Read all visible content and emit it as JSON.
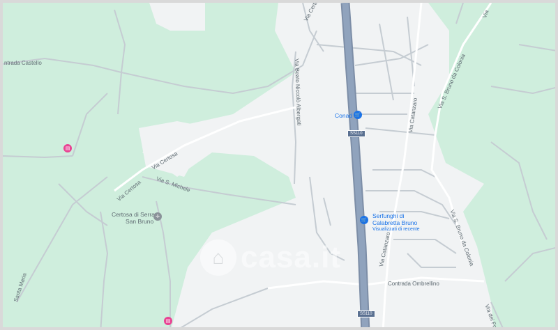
{
  "map": {
    "road_labels": {
      "strada_castello": "ntrada Castello",
      "via_certosa_upper": "Via Certosa",
      "via_certosa_lower": "Via Certosa",
      "via_s_michele": "Via S. Michele",
      "santa_maria": "Santa Maria",
      "via_beato": "Via Beato Niccolò Albergati",
      "via_catanzaro_upper": "Via Catanzaro",
      "via_catanzaro_lower": "Via Catanzaro",
      "via_bruno_upper": "Via S. Bruno da Colonia",
      "via_bruno_lower": "Via S. Bruno da Colonia",
      "contrada_ombrellino": "Contrada Ombrellino",
      "via_certosa_top": "Via Certosa",
      "via_top_right": "Via",
      "via_dei_fo": "Via dei Fo"
    },
    "route_shields": {
      "ss110_upper": "SS110",
      "ss110_lower": "SS110"
    },
    "pois": {
      "conad": {
        "name": "Conad",
        "icon": "shopping-cart-icon"
      },
      "serfunghi": {
        "name_line1": "Serfunghi di",
        "name_line2": "Calabretta Bruno",
        "subtitle": "Visualizzati di recente",
        "icon": "shopping-cart-icon"
      },
      "certosa": {
        "name_line1": "Certosa di Serra",
        "name_line2": "San Bruno",
        "icon": "church-icon"
      },
      "hotel": {
        "icon": "bed-icon"
      },
      "bottom_pin": {
        "icon": "bed-icon"
      }
    },
    "watermark": {
      "text": "casa.it"
    },
    "colors": {
      "park": "#cfeedd",
      "urban": "#f1f3f4",
      "road": "#ffffff",
      "road_outline": "#c5ccd2",
      "highway": "#8d9fb8",
      "poi_blue": "#1a73e8",
      "poi_pink": "#e84393"
    }
  }
}
